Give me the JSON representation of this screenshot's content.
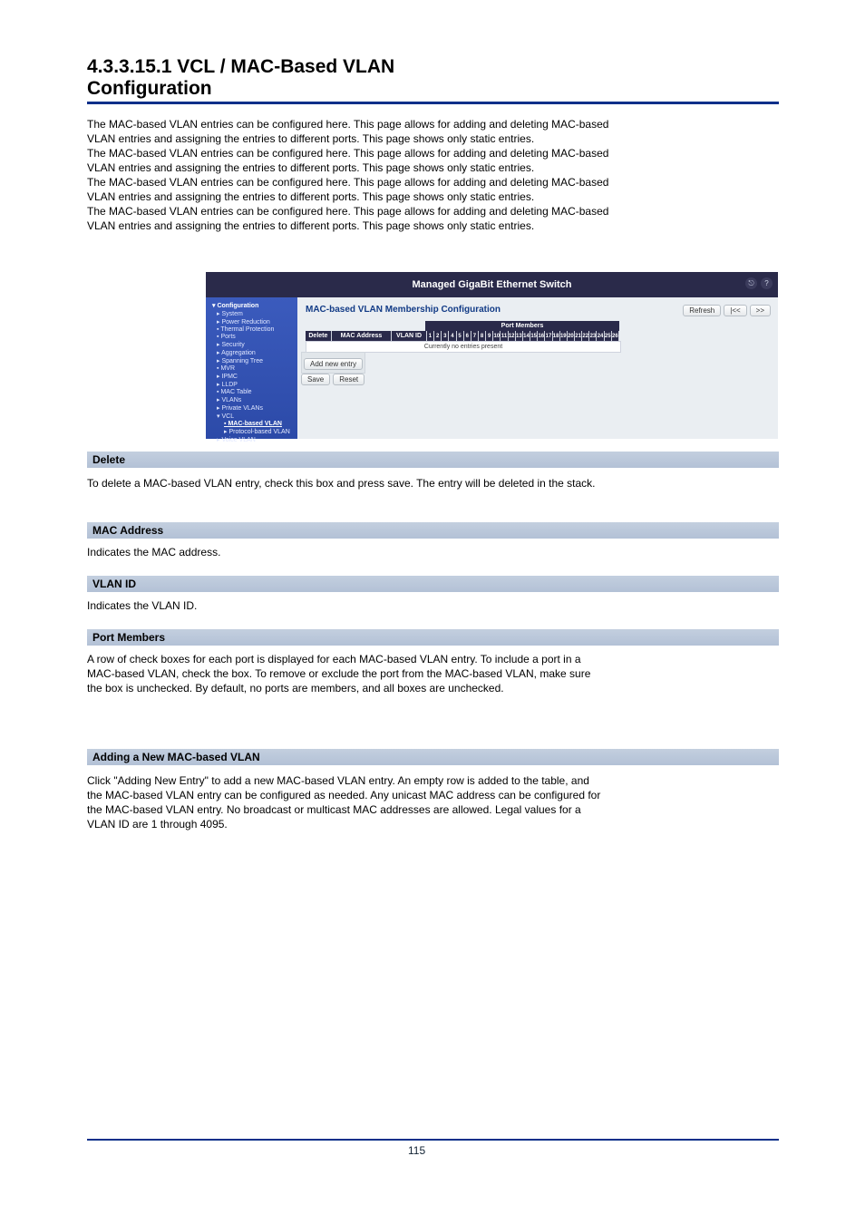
{
  "doc": {
    "heading_l1_a": "4.3.3.15.1 VCL / MAC-Based VLAN",
    "heading_l1_b": "Configuration ",
    "p1": "The MAC-based VLAN entries can be configured here. This page allows for adding and deleting MAC-based",
    "p2": "VLAN entries and assigning the entries to different ports. This page shows only static entries.",
    "p3": "The MAC-based VLAN entries can be configured here. This page allows for adding and deleting MAC-based",
    "p4": "VLAN entries and assigning the entries to different ports. This page shows only static entries.",
    "p5": "The MAC-based VLAN entries can be configured here. This page allows for adding and deleting MAC-based",
    "p6": "VLAN entries and assigning the entries to different ports. This page shows only static entries.",
    "p7a": "The MAC-based VLAN entries can be configured here. This page allows for adding and deleting MAC-based",
    "p7b": "VLAN entries and assigning the entries to different ports. This page shows only static entries.",
    "band1": "Delete",
    "txt1": "To delete a MAC-based VLAN entry, check this box and press save. The entry will be deleted in the stack.",
    "band2": "MAC Address",
    "txt2": "Indicates the MAC address.",
    "band3": "VLAN ID",
    "txt3": "Indicates the VLAN ID.",
    "band4": "Port Members",
    "txt4a": "A row of check boxes for each port is displayed for each MAC-based VLAN entry. To include a port in a",
    "txt4b": "MAC-based VLAN, check the box. To remove or exclude the port from the MAC-based VLAN, make sure",
    "txt4c": "the box is unchecked. By default, no ports are members, and all boxes are unchecked.",
    "txt4d": "",
    "band5": "Adding a New MAC-based VLAN",
    "txt5a": "Click \"Adding New Entry\" to add a new MAC-based VLAN entry. An empty row is added to the table, and",
    "txt5b": "the MAC-based VLAN entry can be configured as needed. Any unicast MAC address can be configured for",
    "txt5c": "the MAC-based VLAN entry. No broadcast or multicast MAC addresses are allowed. Legal values for a",
    "txt5d": "VLAN ID are 1 through 4095.",
    "txt5e": "",
    "pagenum": "115"
  },
  "shot": {
    "title": "Managed GigaBit Ethernet Switch",
    "pane_title": "MAC-based VLAN Membership Configuration",
    "btn_refresh": "Refresh",
    "btn_prev": "|<<",
    "btn_next": ">>",
    "add_btn": "Add new entry",
    "save_btn": "Save",
    "reset_btn": "Reset",
    "table": {
      "port_members_head": "Port Members",
      "delete": "Delete",
      "mac": "MAC Address",
      "vlan": "VLAN ID",
      "ports": [
        "1",
        "2",
        "3",
        "4",
        "5",
        "6",
        "7",
        "8",
        "9",
        "10",
        "11",
        "12",
        "13",
        "14",
        "15",
        "16",
        "17",
        "18",
        "19",
        "20",
        "21",
        "22",
        "23",
        "24",
        "25",
        "26"
      ],
      "empty": "Currently no entries present"
    },
    "nav": {
      "configuration": "Configuration",
      "items": [
        "System",
        "Power Reduction",
        "Thermal Protection",
        "Ports",
        "Security",
        "Aggregation",
        "Spanning Tree",
        "MVR",
        "IPMC",
        "LLDP",
        "MAC Table",
        "VLANs",
        "Private VLANs"
      ],
      "vcl": "VCL",
      "vcl_children": [
        "MAC-based VLAN",
        "Protocol-based VLAN"
      ],
      "voice": "Voice VLAN"
    }
  }
}
